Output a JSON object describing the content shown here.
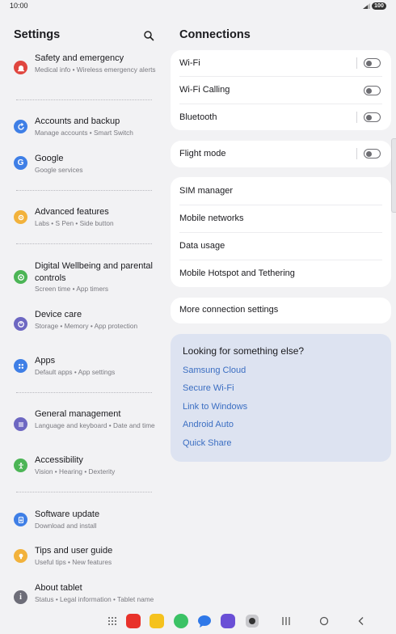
{
  "status": {
    "time": "10:00",
    "battery": "100"
  },
  "left": {
    "title": "Settings",
    "items": [
      {
        "title": "Safety and emergency",
        "sub": "Medical info  •  Wireless emergency alerts",
        "color": "#e0463f",
        "icon": "siren-icon"
      },
      {
        "title": "Accounts and backup",
        "sub": "Manage accounts  •  Smart Switch",
        "color": "#3f7fe6",
        "icon": "sync-icon"
      },
      {
        "title": "Google",
        "sub": "Google services",
        "color": "#3f7fe6",
        "icon": "google-icon"
      },
      {
        "title": "Advanced features",
        "sub": "Labs  •  S Pen  •  Side button",
        "color": "#f2b23c",
        "icon": "gear-plus-icon"
      },
      {
        "title": "Digital Wellbeing and parental controls",
        "sub": "Screen time  •  App timers",
        "color": "#4cb556",
        "icon": "wellbeing-icon"
      },
      {
        "title": "Device care",
        "sub": "Storage  •  Memory  •  App protection",
        "color": "#6d67c2",
        "icon": "device-care-icon"
      },
      {
        "title": "Apps",
        "sub": "Default apps  •  App settings",
        "color": "#3f7fe6",
        "icon": "apps-grid-icon"
      },
      {
        "title": "General management",
        "sub": "Language and keyboard  •  Date and time",
        "color": "#6d67c2",
        "icon": "sliders-icon"
      },
      {
        "title": "Accessibility",
        "sub": "Vision  •  Hearing  •  Dexterity",
        "color": "#4cb556",
        "icon": "accessibility-icon"
      },
      {
        "title": "Software update",
        "sub": "Download and install",
        "color": "#3f7fe6",
        "icon": "update-icon"
      },
      {
        "title": "Tips and user guide",
        "sub": "Useful tips  •  New features",
        "color": "#f2b23c",
        "icon": "lightbulb-icon"
      },
      {
        "title": "About tablet",
        "sub": "Status  •  Legal information  •  Tablet name",
        "color": "#6d6d78",
        "icon": "info-icon"
      }
    ]
  },
  "right": {
    "title": "Connections",
    "wifi": "Wi-Fi",
    "wifi_calling": "Wi-Fi Calling",
    "bluetooth": "Bluetooth",
    "flight_mode": "Flight mode",
    "sim_manager": "SIM manager",
    "mobile_networks": "Mobile networks",
    "data_usage": "Data usage",
    "hotspot": "Mobile Hotspot and Tethering",
    "more": "More connection settings",
    "suggest_title": "Looking for something else?",
    "links": [
      "Samsung Cloud",
      "Secure Wi-Fi",
      "Link to Windows",
      "Android Auto",
      "Quick Share"
    ]
  },
  "colors": {
    "accent": "#3b6ec2",
    "suggest_bg": "#dde3f1"
  }
}
